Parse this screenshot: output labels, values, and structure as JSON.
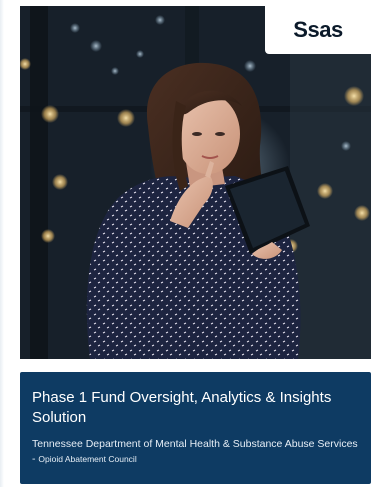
{
  "logo": {
    "text": "Ssas",
    "icon": "sas-logo-icon"
  },
  "photo": {
    "icon": "woman-with-tablet-photo"
  },
  "cover": {
    "title": "Phase 1 Fund Oversight, Analytics & Insights Solution",
    "subtitle_main": "Tennessee Department of Mental Health & Substance Abuse Services - ",
    "subtitle_small": "Opioid Abatement Council"
  },
  "colors": {
    "title_box": "#0e3b63",
    "background": "#ffffff"
  }
}
